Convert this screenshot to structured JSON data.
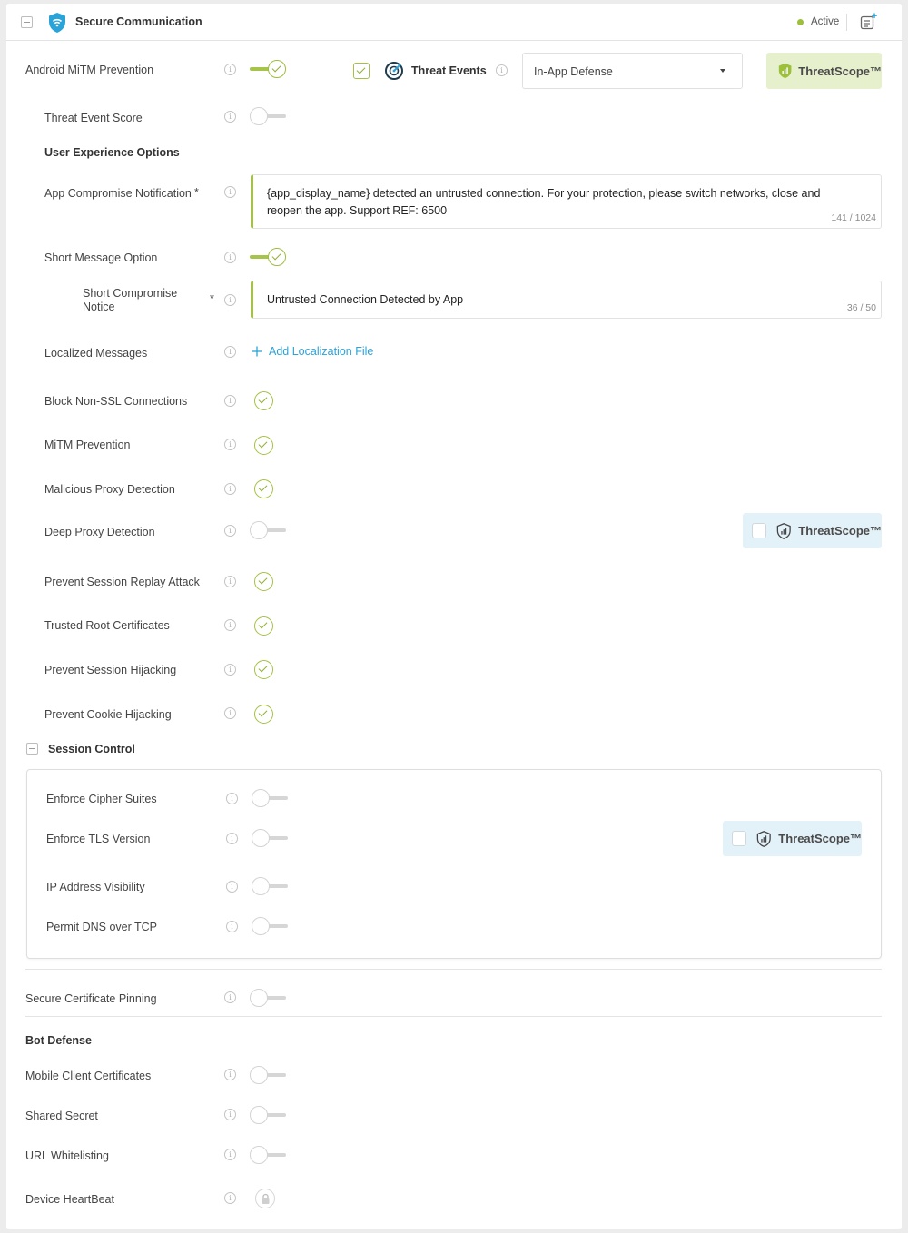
{
  "header": {
    "title": "Secure Communication",
    "status": "Active",
    "status_color": "#9cc03a"
  },
  "threat_events": {
    "label": "Threat Events",
    "select_value": "In-App Defense"
  },
  "threatscope": {
    "label": "ThreatScope™"
  },
  "rows": {
    "android_mitm": "Android MiTM Prevention",
    "threat_event_score": "Threat Event Score",
    "ux_options": "User Experience Options",
    "app_compromise": "App Compromise Notification",
    "app_compromise_text": "{app_display_name} detected an untrusted connection. For your protection, please switch networks, close and reopen the app. Support REF: 6500",
    "app_compromise_count": "141 / 1024",
    "short_message": "Short Message Option",
    "short_compromise_line1": "Short Compromise",
    "short_compromise_line2": "Notice",
    "short_compromise_text": "Untrusted Connection Detected by App",
    "short_compromise_count": "36 / 50",
    "localized_messages": "Localized Messages",
    "add_localization": "Add Localization File",
    "block_non_ssl": "Block Non-SSL Connections",
    "mitm_prevention": "MiTM Prevention",
    "malicious_proxy": "Malicious Proxy Detection",
    "deep_proxy": "Deep Proxy Detection",
    "session_replay": "Prevent Session Replay Attack",
    "trusted_root": "Trusted Root Certificates",
    "session_hijacking": "Prevent Session Hijacking",
    "cookie_hijacking": "Prevent Cookie Hijacking",
    "required_mark": "*"
  },
  "session_control": {
    "title": "Session Control",
    "enforce_cipher": "Enforce Cipher Suites",
    "enforce_tls": "Enforce TLS Version",
    "ip_visibility": "IP Address Visibility",
    "permit_dns": "Permit DNS over TCP"
  },
  "secure_cert_pinning": "Secure Certificate Pinning",
  "bot_defense": {
    "title": "Bot Defense",
    "mobile_client_certs": "Mobile Client Certificates",
    "shared_secret": "Shared Secret",
    "url_whitelisting": "URL Whitelisting",
    "device_heartbeat": "Device HeartBeat"
  },
  "icons": {
    "info": "info-icon",
    "shield": "shield-wifi-icon",
    "radar": "radar-icon",
    "plus": "plus-icon",
    "lock": "lock-icon",
    "notes_add": "notes-add-icon"
  },
  "colors": {
    "accent_green": "#a3c142",
    "link_blue": "#2aa3d8",
    "badge_blue": "#e3f1f8",
    "badge_green": "#e6f0cc"
  }
}
